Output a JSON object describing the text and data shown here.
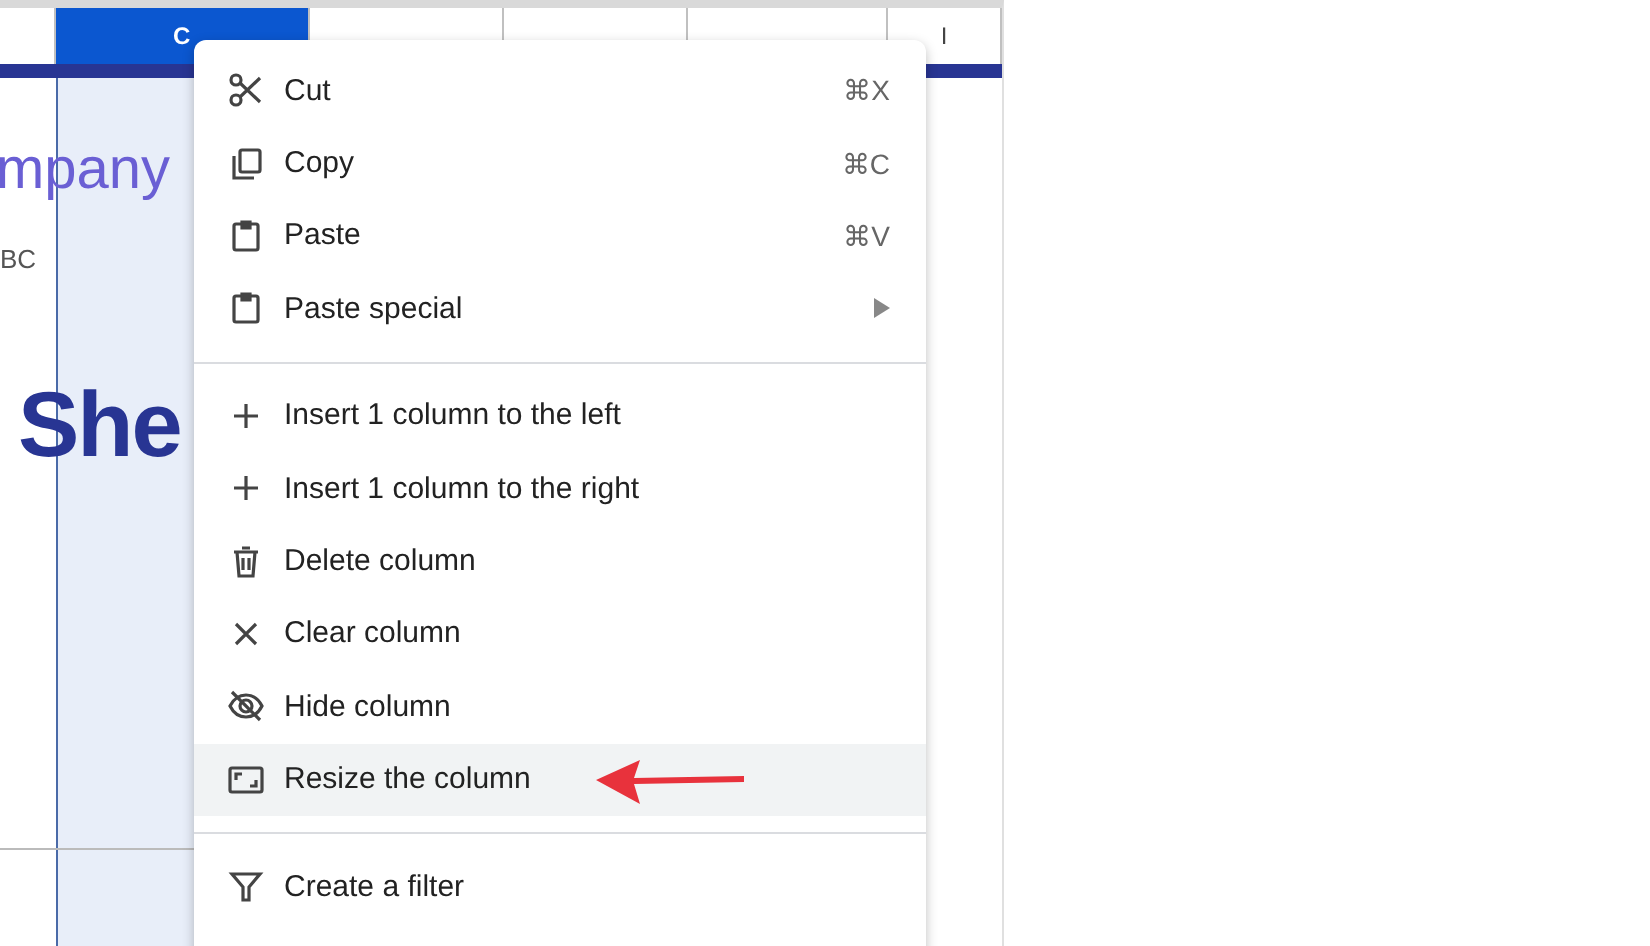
{
  "columns": [
    {
      "label": "C",
      "selected": true
    },
    {
      "selected": false
    },
    {
      "selected": false
    },
    {
      "selected": false
    },
    {
      "label": "I",
      "selected": false
    }
  ],
  "cells": [
    {
      "kind": "subtitle",
      "text": "mpany"
    },
    {
      "kind": "small",
      "text": "BC"
    },
    {
      "kind": "title",
      "text": "She"
    }
  ],
  "context_menu": {
    "sections": [
      {
        "items": [
          {
            "kind": "scissors",
            "label": "Cut",
            "shortcut": "⌘X",
            "submenu": false,
            "selected": false
          },
          {
            "kind": "copy",
            "label": "Copy",
            "shortcut": "⌘C",
            "submenu": false,
            "selected": false
          },
          {
            "kind": "clipboard",
            "label": "Paste",
            "shortcut": "⌘V",
            "submenu": false,
            "selected": false
          },
          {
            "kind": "clipboard",
            "label": "Paste special",
            "submenu": true,
            "selected": false
          }
        ]
      },
      {
        "items": [
          {
            "kind": "plus",
            "label": "Insert 1 column to the left",
            "submenu": false,
            "selected": false
          },
          {
            "kind": "plus",
            "label": "Insert 1 column to the right",
            "submenu": false,
            "selected": false
          },
          {
            "kind": "trash",
            "label": "Delete column",
            "submenu": false,
            "selected": false
          },
          {
            "kind": "x",
            "label": "Clear column",
            "submenu": false,
            "selected": false
          },
          {
            "kind": "eye-off",
            "label": "Hide column",
            "submenu": false,
            "selected": false
          },
          {
            "kind": "resize",
            "label": "Resize the column",
            "submenu": false,
            "selected": true
          }
        ]
      },
      {
        "items": [
          {
            "kind": "filter",
            "label": "Create a filter",
            "submenu": false,
            "selected": false
          }
        ]
      }
    ]
  },
  "annotation": {
    "kind": "arrow",
    "color": "#e8323c"
  }
}
